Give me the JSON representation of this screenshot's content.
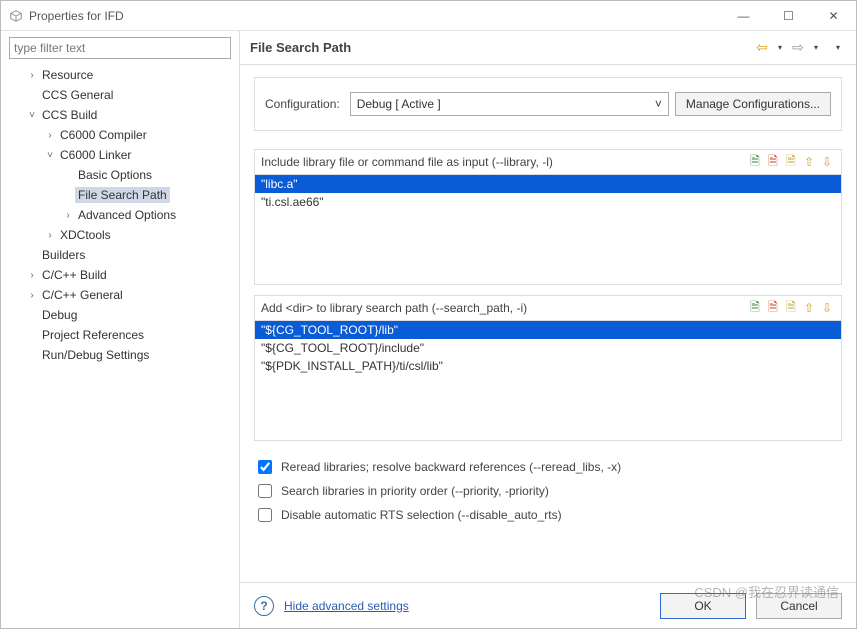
{
  "window": {
    "title": "Properties for IFD"
  },
  "filter": {
    "placeholder": "type filter text"
  },
  "tree": [
    {
      "label": "Resource",
      "depth": 1,
      "tw": "›"
    },
    {
      "label": "CCS General",
      "depth": 1,
      "tw": ""
    },
    {
      "label": "CCS Build",
      "depth": 1,
      "tw": "˅"
    },
    {
      "label": "C6000 Compiler",
      "depth": 2,
      "tw": "›"
    },
    {
      "label": "C6000 Linker",
      "depth": 2,
      "tw": "˅"
    },
    {
      "label": "Basic Options",
      "depth": 3,
      "tw": ""
    },
    {
      "label": "File Search Path",
      "depth": 3,
      "tw": "",
      "sel": true
    },
    {
      "label": "Advanced Options",
      "depth": 3,
      "tw": "›"
    },
    {
      "label": "XDCtools",
      "depth": 2,
      "tw": "›"
    },
    {
      "label": "Builders",
      "depth": 1,
      "tw": ""
    },
    {
      "label": "C/C++ Build",
      "depth": 1,
      "tw": "›"
    },
    {
      "label": "C/C++ General",
      "depth": 1,
      "tw": "›"
    },
    {
      "label": "Debug",
      "depth": 1,
      "tw": ""
    },
    {
      "label": "Project References",
      "depth": 1,
      "tw": ""
    },
    {
      "label": "Run/Debug Settings",
      "depth": 1,
      "tw": ""
    }
  ],
  "page": {
    "title": "File Search Path"
  },
  "config": {
    "label": "Configuration:",
    "value": "Debug  [ Active ]",
    "manage": "Manage Configurations..."
  },
  "panel1": {
    "title": "Include library file or command file as input (--library, -l)",
    "items": [
      {
        "text": "\"libc.a\"",
        "sel": true
      },
      {
        "text": "\"ti.csl.ae66\""
      }
    ]
  },
  "panel2": {
    "title": "Add <dir> to library search path (--search_path, -i)",
    "items": [
      {
        "text": "\"${CG_TOOL_ROOT}/lib\"",
        "sel": true
      },
      {
        "text": "\"${CG_TOOL_ROOT}/include\""
      },
      {
        "text": "\"${PDK_INSTALL_PATH}/ti/csl/lib\""
      }
    ]
  },
  "checks": [
    {
      "label": "Reread libraries; resolve backward references (--reread_libs, -x)",
      "checked": true
    },
    {
      "label": "Search libraries in priority order (--priority, -priority)",
      "checked": false
    },
    {
      "label": "Disable automatic RTS selection (--disable_auto_rts)",
      "checked": false
    }
  ],
  "footer": {
    "hide": "Hide advanced settings",
    "ok": "OK",
    "cancel": "Cancel"
  },
  "watermark": "CSDN @我在忍界读通信"
}
